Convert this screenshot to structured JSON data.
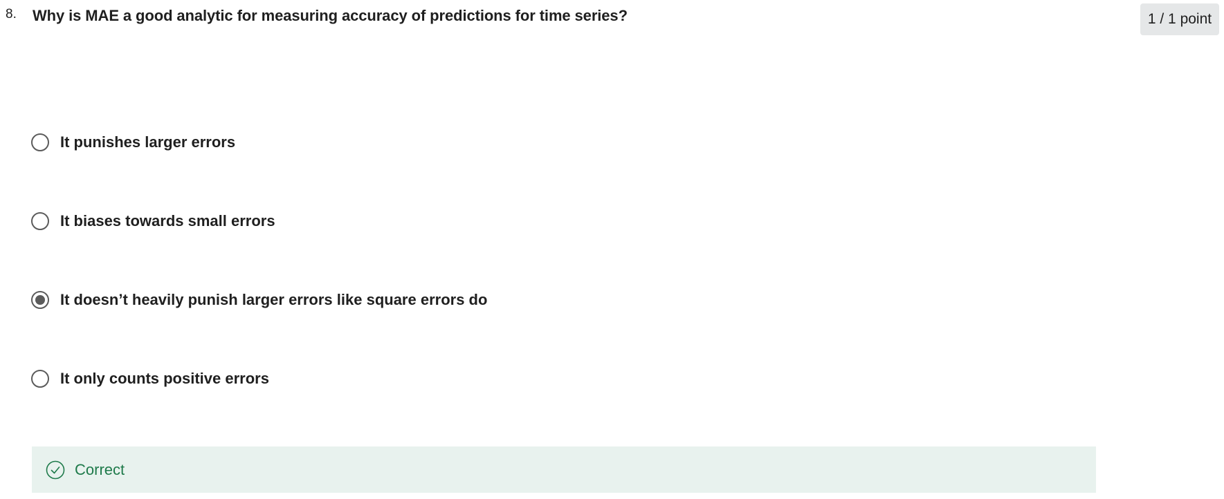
{
  "question": {
    "number": "8.",
    "text": "Why is MAE a good analytic for measuring accuracy of predictions for time series?",
    "points": "1 / 1 point"
  },
  "options": [
    {
      "label": "It punishes larger errors",
      "selected": false
    },
    {
      "label": "It biases towards small errors",
      "selected": false
    },
    {
      "label": "It doesn’t heavily punish larger errors like square errors do",
      "selected": true
    },
    {
      "label": "It only counts positive errors",
      "selected": false
    }
  ],
  "feedback": {
    "text": "Correct",
    "icon": "check-circle-icon",
    "color": "#1e7a4a",
    "background": "#e8f2ee"
  }
}
